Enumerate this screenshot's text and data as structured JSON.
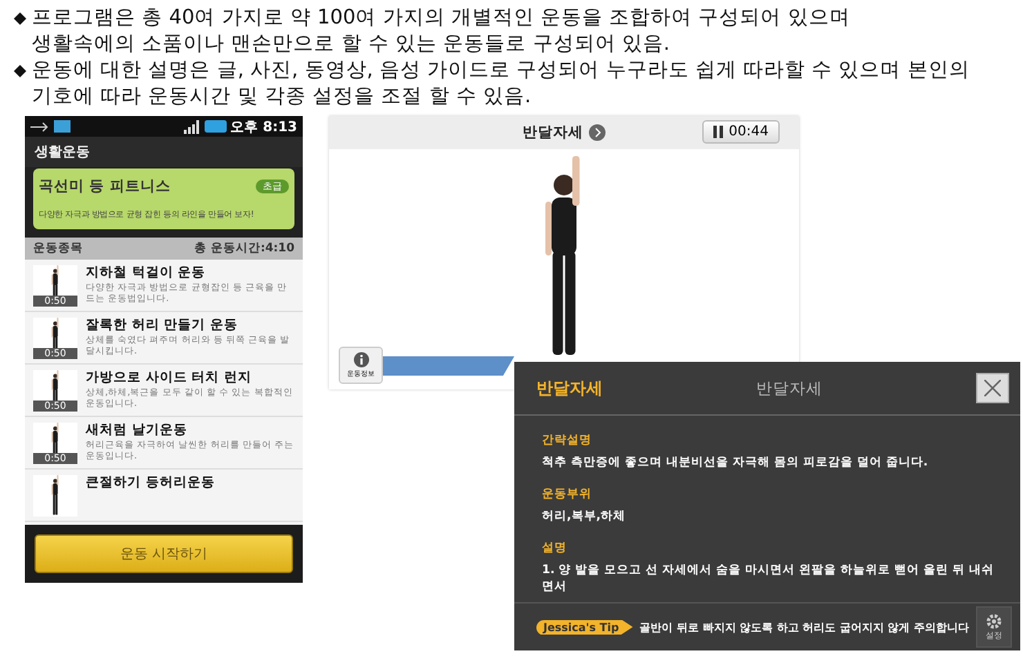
{
  "bullets": [
    "프로그램은 총 40여 가지로 약 100여 가지의 개별적인 운동을 조합하여 구성되어 있으며\n생활속에의 소품이나 맨손만으로 할 수 있는 운동들로 구성되어 있음.",
    "운동에 대한 설명은 글, 사진, 동영상, 음성 가이드로 구성되어 누구라도 쉽게 따라할 수 있으며 본인의\n기호에 따라 운동시간 및 각종 설정을 조절 할 수 있음."
  ],
  "phone": {
    "status_time": "오후 8:13",
    "title": "생활운동",
    "program": {
      "name": "곡선미 등 피트니스",
      "level": "초급",
      "description": "다양한 자극과 방법으로 균형 잡힌 등의 라인을 만들어 보자!"
    },
    "list_header": {
      "label": "운동종목",
      "total": "총 운동시간:4:10"
    },
    "exercises": [
      {
        "name": "지하철 턱걸이 운동",
        "description": "다양한 자극과 방법으로 균형잡인 등 근육을 만드는 운동법입니다.",
        "duration": "0:50"
      },
      {
        "name": "잘록한 허리 만들기 운동",
        "description": "상체를 숙였다 펴주며 허리와 등 뒤쪽 근육을 발달시킵니다.",
        "duration": "0:50"
      },
      {
        "name": "가방으로 사이드 터치 런지",
        "description": "상체,하체,복근을 모두 같이 할 수 있는 복합적인 운동입니다.",
        "duration": "0:50"
      },
      {
        "name": "새처럼 날기운동",
        "description": "허리근육을 자극하여 날씬한 허리를 만들어 주는 운동입니다.",
        "duration": "0:50"
      },
      {
        "name": "큰절하기 등허리운동"
      }
    ],
    "start_button": "운동 시작하기"
  },
  "video": {
    "title": "반달자세",
    "timer": "00:44",
    "info_button": "운동정보"
  },
  "overlay": {
    "title": "반달자세",
    "background_title": "반달자세",
    "sections": [
      {
        "label": "간략설명",
        "text": "척추 측만증에 좋으며 내분비선을 자극해 몸의 피로감을 덜어 줍니다."
      },
      {
        "label": "운동부위",
        "text": "허리,복부,하체"
      },
      {
        "label": "설명",
        "text": "1. 양 발을 모으고 선 자세에서 숨을 마시면서 왼팔을 하늘위로 뻗어 올린 뒤 내쉬면서"
      }
    ],
    "tip_badge": "Jessica's Tip",
    "tip": "골반이 뒤로 빠지지 않도록 하고 허리도 굽어지지 않게 주의합니다",
    "settings_button": "설정"
  }
}
